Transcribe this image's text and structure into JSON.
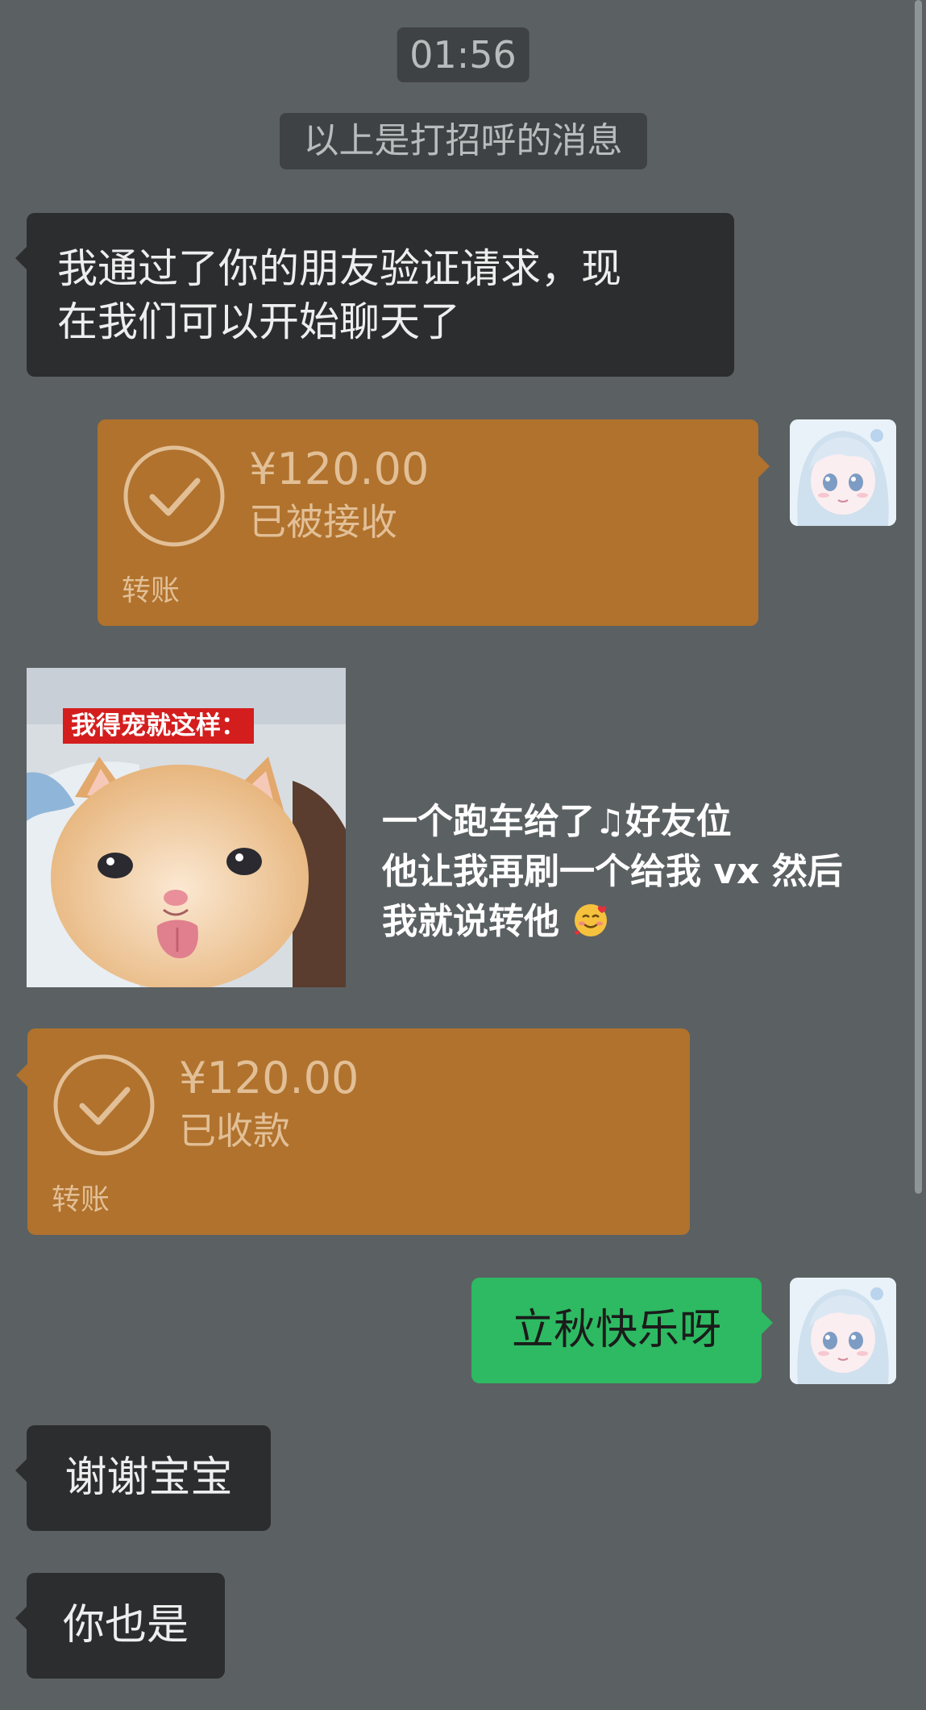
{
  "chat": {
    "timestamp": "01:56",
    "system_hint": "以上是打招呼的消息",
    "messages": [
      {
        "type": "text",
        "side": "left",
        "text_line1": "我通过了你的朋友验证请求，现",
        "text_line2": "在我们可以开始聊天了"
      },
      {
        "type": "transfer",
        "side": "right",
        "amount": "¥120.00",
        "status": "已被接收",
        "label": "转账"
      },
      {
        "type": "image",
        "side": "left",
        "caption": "我得宠就这样："
      },
      {
        "type": "free_text",
        "line1_a": "一个跑车给了",
        "line1_b": "好友位",
        "line2": "他让我再刷一个给我 vx 然后",
        "line3": "我就说转他"
      },
      {
        "type": "transfer",
        "side": "left",
        "amount": "¥120.00",
        "status": "已收款",
        "label": "转账"
      },
      {
        "type": "text",
        "side": "right",
        "text": "立秋快乐呀"
      },
      {
        "type": "text",
        "side": "left",
        "text": "谢谢宝宝"
      },
      {
        "type": "text",
        "side": "left",
        "text": "你也是"
      }
    ]
  },
  "colors": {
    "background": "#5b6063",
    "incoming_bubble": "#2c2d2e",
    "outgoing_bubble": "#2dba62",
    "transfer_card": "#b0722d"
  },
  "icons": {
    "transfer_check": "check-circle-icon",
    "music_note": "music-note-icon",
    "emoji": "smiling-face-with-hearts-icon",
    "avatar": "anime-avatar-icon"
  }
}
